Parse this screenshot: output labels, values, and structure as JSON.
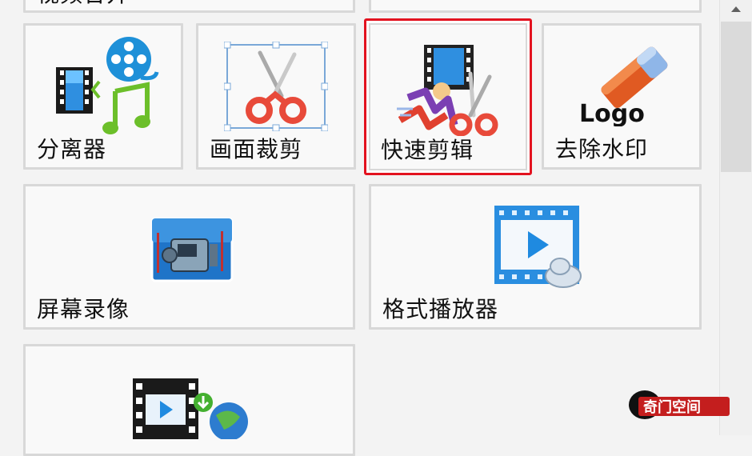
{
  "tools": {
    "row0": [
      {
        "label": "视频合并"
      },
      {
        "label": ""
      }
    ],
    "row1": [
      {
        "label": "分离器",
        "icon": "separator-icon"
      },
      {
        "label": "画面裁剪",
        "icon": "crop-icon"
      },
      {
        "label": "快速剪辑",
        "icon": "quick-edit-icon",
        "selected": true
      },
      {
        "label": "去除水印",
        "icon": "remove-watermark-icon",
        "icon_text": "Logo"
      }
    ],
    "row2": [
      {
        "label": "屏幕录像",
        "icon": "screen-record-icon"
      },
      {
        "label": "格式播放器",
        "icon": "format-player-icon"
      }
    ],
    "row3": [
      {
        "label": "",
        "icon": "video-download-icon"
      }
    ]
  },
  "watermark": {
    "text": "奇门空间"
  },
  "colors": {
    "selection": "#e3121f",
    "tile_border": "#d8d8d8",
    "tile_bg": "#f9f9f9",
    "page_bg": "#f3f3f3"
  }
}
